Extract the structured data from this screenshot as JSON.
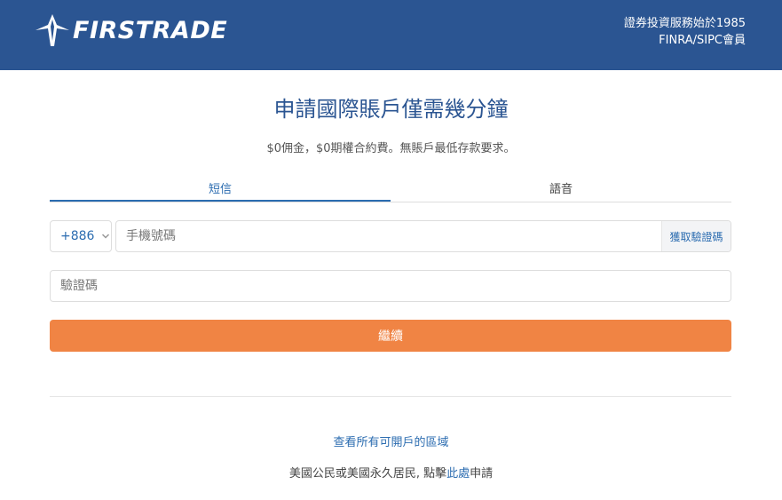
{
  "header": {
    "logo_text": "FIRSTRADE",
    "tagline_1": "證券投資服務始於1985",
    "tagline_2": "FINRA/SIPC會員"
  },
  "main": {
    "title": "申請國際賬戶僅需幾分鐘",
    "subtitle": "$0佣金，$0期權合約費。無賬戶最低存款要求。",
    "tabs": [
      {
        "label": "短信",
        "active": true
      },
      {
        "label": "語音",
        "active": false
      }
    ],
    "country_code": "+886",
    "phone_placeholder": "手機號碼",
    "get_code_label": "獲取驗證碼",
    "code_placeholder": "驗證碼",
    "continue_label": "繼續"
  },
  "footer": {
    "regions_link": "查看所有可開戶的區域",
    "us_prefix": "美國公民或美國永久居民, 點擊",
    "us_link": "此處",
    "us_suffix": "申請"
  },
  "colors": {
    "header_bg": "#2b5592",
    "accent": "#2b6cb0",
    "button": "#f08444"
  },
  "icons": [
    "firstrade-logo-icon",
    "chevron-down-icon"
  ]
}
